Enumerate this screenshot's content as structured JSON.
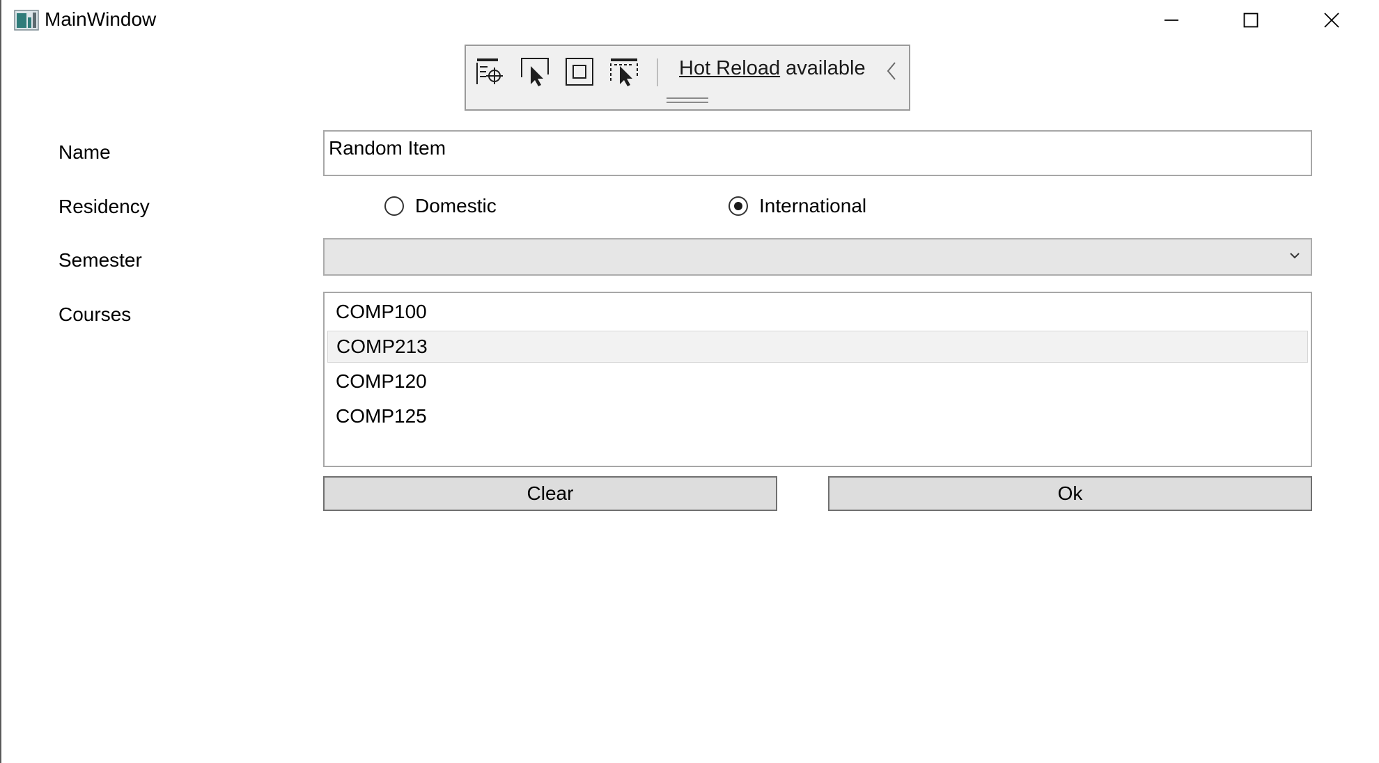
{
  "window": {
    "title": "MainWindow",
    "icon": "wpf-app-icon",
    "controls": [
      "minimize-icon",
      "maximize-icon",
      "close-icon"
    ]
  },
  "debug_toolbar": {
    "buttons": [
      "go-to-live-visual-tree-icon",
      "select-element-icon",
      "display-layout-adorners-icon",
      "track-focused-element-icon"
    ],
    "hot_reload_link": "Hot Reload",
    "hot_reload_suffix": " available",
    "collapse_icon": "chevron-left-icon"
  },
  "form": {
    "name_label": "Name",
    "name_value": "Random Item",
    "residency_label": "Residency",
    "residency_options": [
      {
        "label": "Domestic",
        "checked": false
      },
      {
        "label": "International",
        "checked": true
      }
    ],
    "semester_label": "Semester",
    "semester_value": "",
    "courses_label": "Courses",
    "courses": [
      "COMP100",
      "COMP213",
      "COMP120",
      "COMP125"
    ],
    "highlighted_course": "COMP213",
    "clear_button": "Clear",
    "ok_button": "Ok"
  }
}
